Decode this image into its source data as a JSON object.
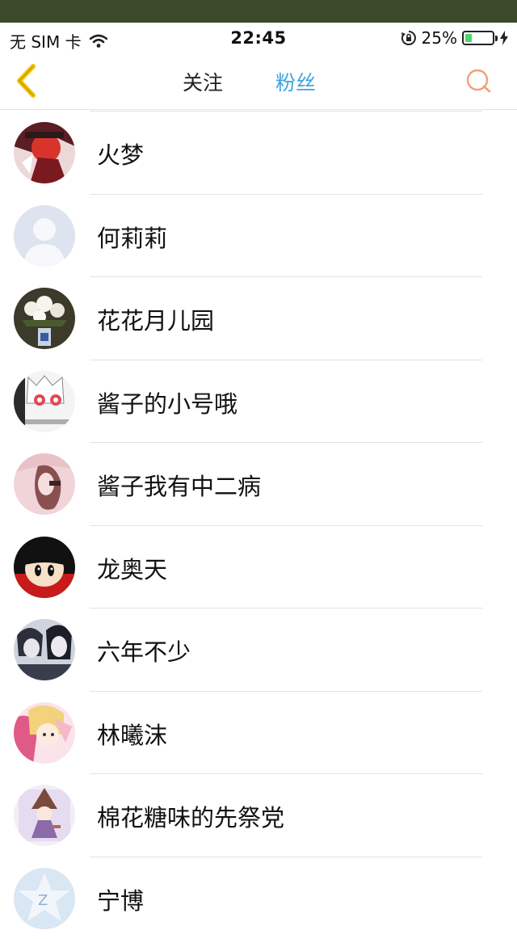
{
  "status_bar": {
    "carrier": "无 SIM 卡",
    "time": "22:45",
    "battery_text": "25%",
    "battery_level": 0.25,
    "battery_color": "#4cd964"
  },
  "nav": {
    "tabs": [
      {
        "label": "关注",
        "active": false
      },
      {
        "label": "粉丝",
        "active": true
      }
    ],
    "active_color": "#3aa5e0",
    "back_icon": "chevron-left-icon",
    "back_color": "#f2c200",
    "search_icon": "search-icon",
    "search_color": "#f0a070"
  },
  "fans": [
    {
      "name": "火梦"
    },
    {
      "name": "何莉莉"
    },
    {
      "name": "花花月儿园"
    },
    {
      "name": "酱子的小号哦"
    },
    {
      "name": "酱子我有中二病"
    },
    {
      "name": "龙奥天"
    },
    {
      "name": "六年不少"
    },
    {
      "name": "林曦沫"
    },
    {
      "name": "棉花糖味的先祭党"
    },
    {
      "name": "宁博"
    }
  ]
}
